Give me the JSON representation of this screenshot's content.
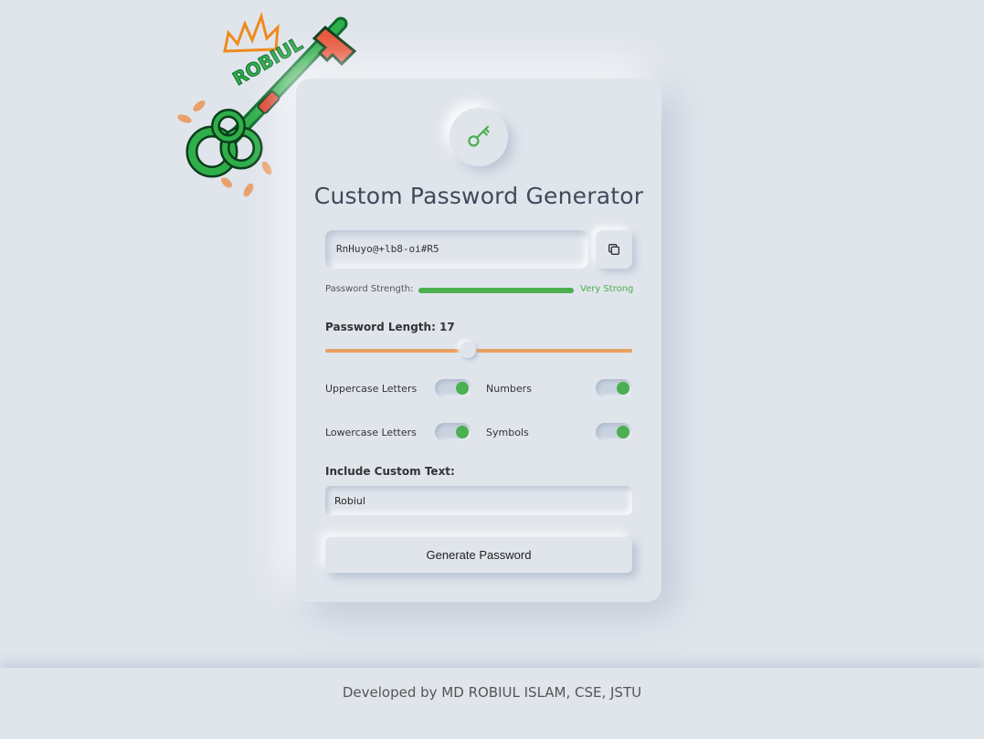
{
  "logo": {
    "text": "ROBIUL"
  },
  "app": {
    "title": "Custom Password Generator"
  },
  "password": {
    "value": "RnHuyo@+lb8-oi#R5"
  },
  "strength": {
    "label": "Password Strength:",
    "text": "Very Strong",
    "level": 1.0,
    "color": "#4caf50"
  },
  "length": {
    "label": "Password Length: 17",
    "value": 17,
    "min": 4,
    "max": 32
  },
  "options": {
    "uppercase": {
      "label": "Uppercase Letters",
      "checked": true
    },
    "numbers": {
      "label": "Numbers",
      "checked": true
    },
    "lowercase": {
      "label": "Lowercase Letters",
      "checked": true
    },
    "symbols": {
      "label": "Symbols",
      "checked": true
    }
  },
  "custom_text": {
    "label": "Include Custom Text:",
    "value": "Robiul"
  },
  "generate": {
    "label": "Generate Password"
  },
  "footer": {
    "text": "Developed by MD ROBIUL ISLAM, CSE, JSTU"
  },
  "colors": {
    "accent": "#4caf50",
    "slider": "#e8a060",
    "background": "#e0e5ec"
  },
  "icons": {
    "header": "key-icon",
    "copy": "copy-icon"
  }
}
